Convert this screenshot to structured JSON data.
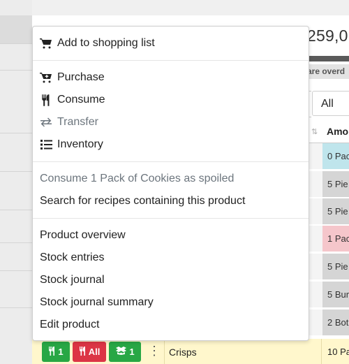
{
  "page": {
    "total_partial": "259,0",
    "overdue_partial": "are overd",
    "filter_value": "All",
    "amount_header": "Amo",
    "rows": [
      {
        "amount": "0 Pac",
        "tone": "cyan"
      },
      {
        "amount": "5 Pie",
        "tone": "gray"
      },
      {
        "amount": "5 Pie",
        "tone": "gray"
      },
      {
        "amount": "1 Pac",
        "tone": "red"
      },
      {
        "amount": "5 Pie",
        "tone": "gray"
      },
      {
        "amount": "5 Bur",
        "tone": "gray"
      },
      {
        "amount": "2 Bot",
        "tone": "gray"
      }
    ]
  },
  "menu": {
    "add_to_shopping_list": "Add to shopping list",
    "purchase": "Purchase",
    "consume": "Consume",
    "transfer": "Transfer",
    "inventory": "Inventory",
    "consume_spoiled": "Consume 1 Pack of Cookies as spoiled",
    "search_recipes": "Search for recipes containing this product",
    "product_overview": "Product overview",
    "stock_entries": "Stock entries",
    "stock_journal": "Stock journal",
    "stock_journal_summary": "Stock journal summary",
    "edit_product": "Edit product"
  },
  "crisps_row": {
    "consume_one": "1",
    "consume_all": "All",
    "open_one": "1",
    "product_name": "Crisps",
    "amount": "10 Pa"
  },
  "icons": {
    "cart": "shopping-cart-icon",
    "cart_plus": "cart-plus-icon",
    "utensils": "utensils-icon",
    "exchange": "exchange-icon",
    "list": "list-icon",
    "box_open": "box-open-icon",
    "kebab": "ellipsis-vertical-icon"
  },
  "colors": {
    "success": "#28a745",
    "danger": "#dc3545",
    "info_row": "#bfe5ec",
    "danger_row": "#f5c6cb",
    "warning_row": "#fff7cc"
  }
}
